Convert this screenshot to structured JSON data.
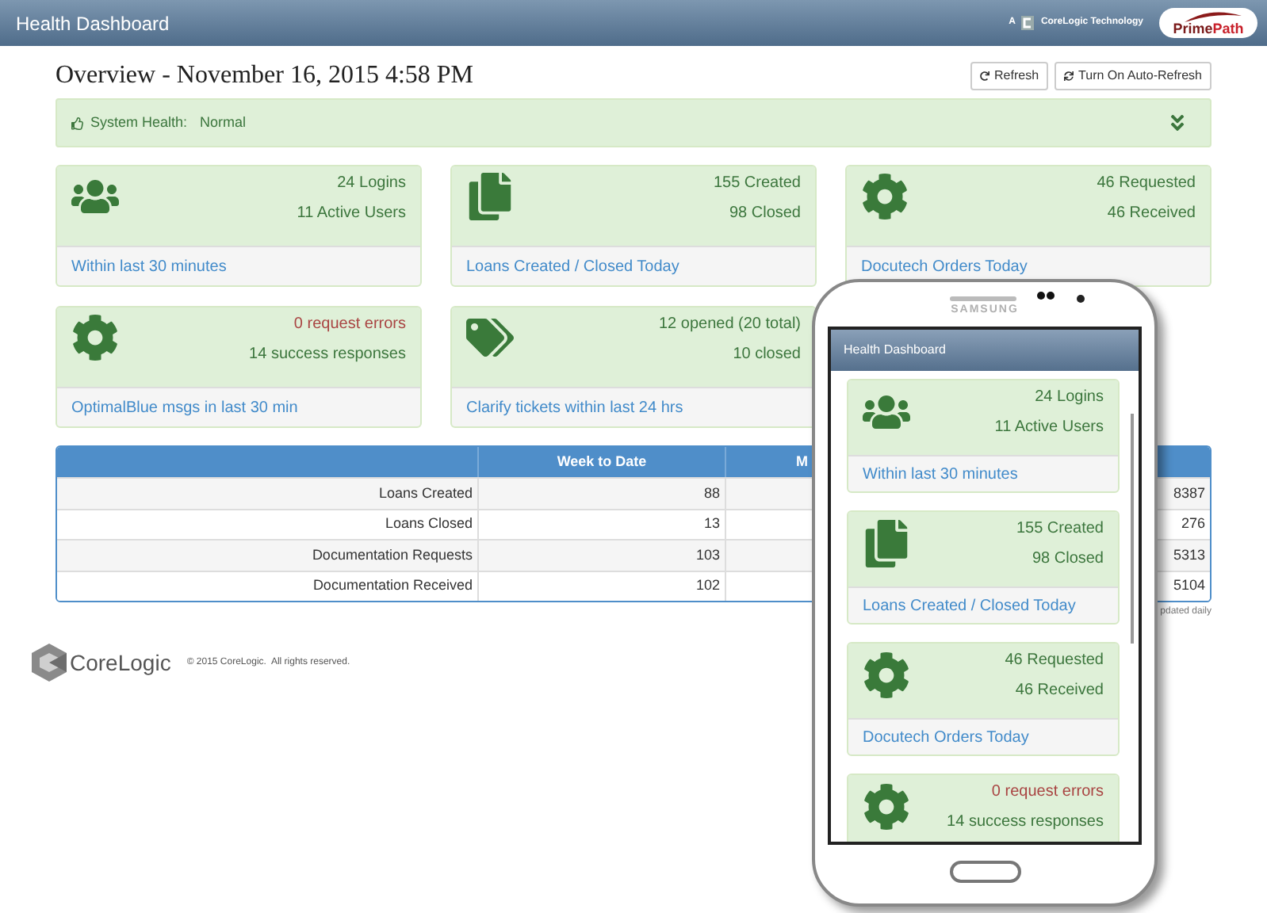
{
  "header": {
    "title": "Health Dashboard",
    "tagline_prefix": "A",
    "tagline": "CoreLogic Technology",
    "brand": {
      "part_1": "Prime",
      "part_2": "Path"
    }
  },
  "overview": {
    "title": "Overview - November 16, 2015 4:58 PM",
    "buttons": [
      {
        "kind": "refresh",
        "label": "Refresh"
      },
      {
        "kind": "sync",
        "label": "Turn On Auto-Refresh"
      }
    ]
  },
  "system_health": {
    "label": "System Health:",
    "status": "Normal",
    "expanded": false
  },
  "cards": [
    {
      "kind": "users",
      "lines": [
        {
          "text": "24 Logins",
          "alert": false
        },
        {
          "text": "11 Active Users",
          "alert": false
        }
      ],
      "footer": "Within last 30 minutes"
    },
    {
      "kind": "files",
      "lines": [
        {
          "text": "155 Created",
          "alert": false
        },
        {
          "text": "98 Closed",
          "alert": false
        }
      ],
      "footer": "Loans Created / Closed Today"
    },
    {
      "kind": "gear",
      "lines": [
        {
          "text": "46 Requested",
          "alert": false
        },
        {
          "text": "46 Received",
          "alert": false
        }
      ],
      "footer": "Docutech Orders Today"
    },
    {
      "kind": "gear",
      "lines": [
        {
          "text": "0 request errors",
          "alert": true
        },
        {
          "text": "14 success responses",
          "alert": false
        }
      ],
      "footer": "OptimalBlue msgs in last 30 min"
    },
    {
      "kind": "tags",
      "lines": [
        {
          "text": "12 opened (20 total)",
          "alert": false
        },
        {
          "text": "10 closed",
          "alert": false
        }
      ],
      "footer": "Clarify tickets within last 24 hrs"
    }
  ],
  "table": {
    "columns": [
      {
        "label": "Week to Date"
      },
      {
        "label": "M"
      }
    ],
    "rows": [
      {
        "label": "Loans Created",
        "week_to_date": "88",
        "column_4": "8387"
      },
      {
        "label": "Loans Closed",
        "week_to_date": "13",
        "column_4": "276"
      },
      {
        "label": "Documentation Requests",
        "week_to_date": "103",
        "column_4": "5313"
      },
      {
        "label": "Documentation Received",
        "week_to_date": "102",
        "column_4": "5104"
      }
    ],
    "note": "pdated daily"
  },
  "footer": {
    "brand": "CoreLogic",
    "copyright": "© 2015 CoreLogic.  All rights reserved."
  },
  "phone": {
    "maker": "SAMSUNG",
    "title": "Health Dashboard",
    "cards": [
      {
        "kind": "users",
        "lines": [
          {
            "text": "24 Logins",
            "alert": false
          },
          {
            "text": "11 Active Users",
            "alert": false
          }
        ],
        "footer": "Within last 30 minutes"
      },
      {
        "kind": "files",
        "lines": [
          {
            "text": "155 Created",
            "alert": false
          },
          {
            "text": "98 Closed",
            "alert": false
          }
        ],
        "footer": "Loans Created / Closed Today"
      },
      {
        "kind": "gear",
        "lines": [
          {
            "text": "46 Requested",
            "alert": false
          },
          {
            "text": "46 Received",
            "alert": false
          }
        ],
        "footer": "Docutech Orders Today"
      },
      {
        "kind": "gear",
        "lines": [
          {
            "text": "0 request errors",
            "alert": true
          },
          {
            "text": "14 success responses",
            "alert": false
          }
        ]
      }
    ]
  }
}
